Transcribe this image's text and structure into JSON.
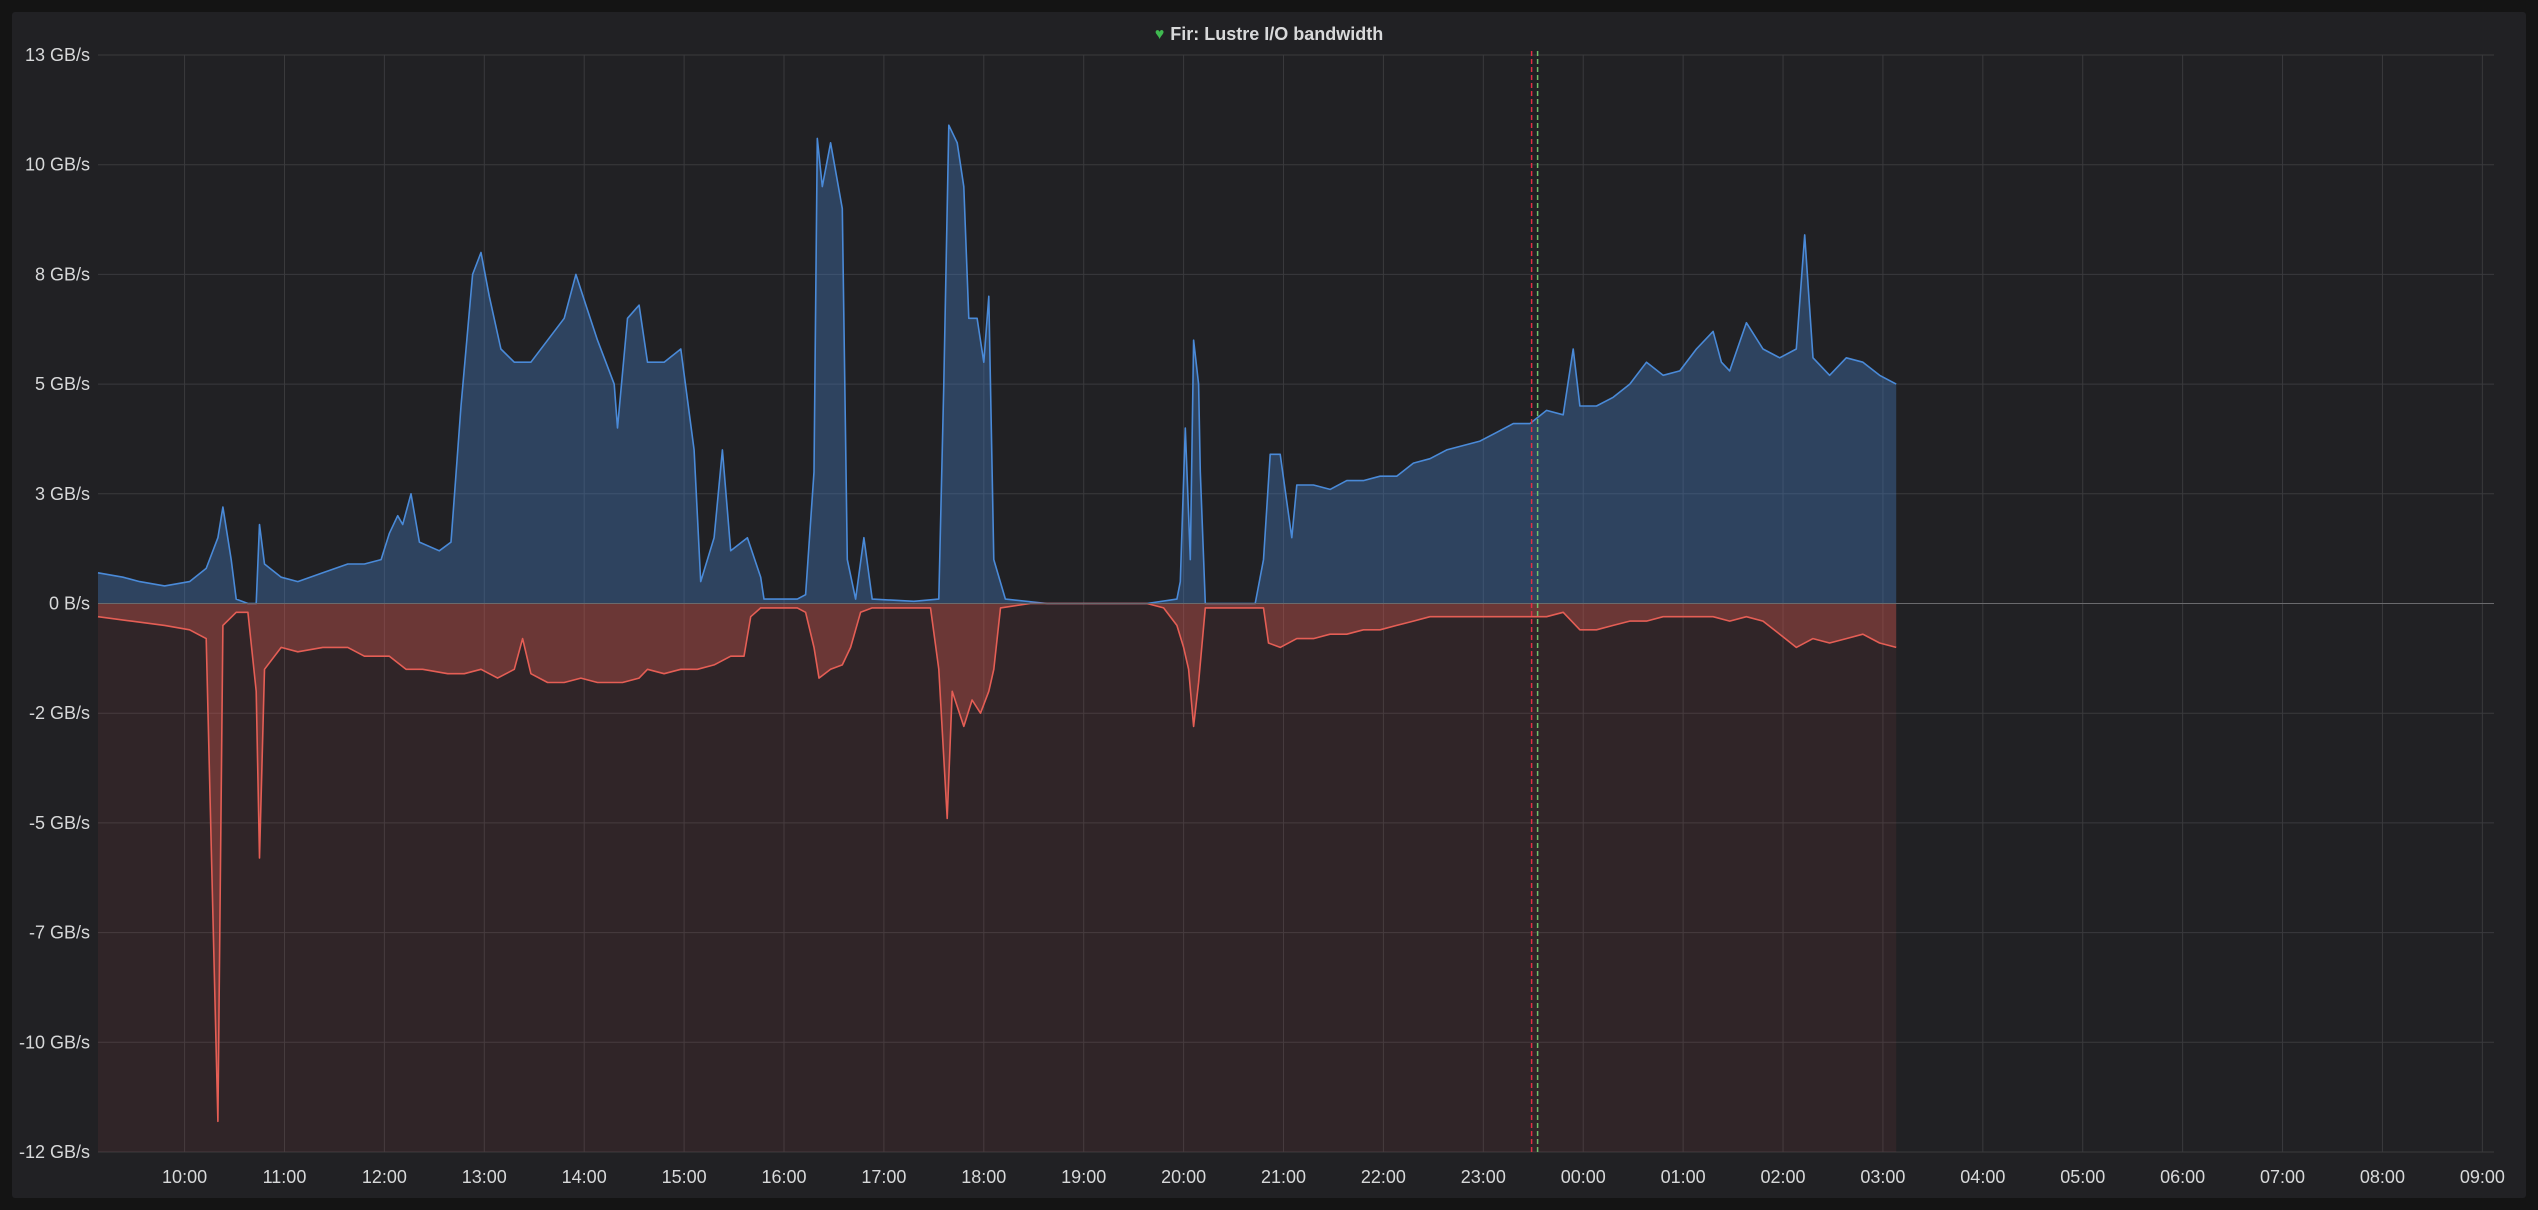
{
  "panel": {
    "title": "Fir: Lustre I/O bandwidth",
    "status_icon": "heart-icon",
    "status_color": "#3fb950"
  },
  "colors": {
    "read": "#4a8ad8",
    "write": "#e55f55",
    "annotation_red": "#e02f44",
    "annotation_green": "#73bf69"
  },
  "chart_data": {
    "type": "area",
    "title": "Fir: Lustre I/O bandwidth",
    "xlabel": "",
    "ylabel": "",
    "y_unit": "GB/s",
    "ylim": [
      -12.5,
      12.5
    ],
    "grid": true,
    "legend": "none",
    "y_ticks": [
      {
        "value": 12.5,
        "label": "13 GB/s"
      },
      {
        "value": 10.0,
        "label": "10 GB/s"
      },
      {
        "value": 7.5,
        "label": "8 GB/s"
      },
      {
        "value": 5.0,
        "label": "5 GB/s"
      },
      {
        "value": 2.5,
        "label": "3 GB/s"
      },
      {
        "value": 0.0,
        "label": "0 B/s"
      },
      {
        "value": -2.5,
        "label": "-2 GB/s"
      },
      {
        "value": -5.0,
        "label": "-5 GB/s"
      },
      {
        "value": -7.5,
        "label": "-7 GB/s"
      },
      {
        "value": -10.0,
        "label": "-10 GB/s"
      },
      {
        "value": -12.5,
        "label": "-12 GB/s"
      }
    ],
    "x_range": [
      "09:08",
      "09:07"
    ],
    "x_ticks": [
      "10:00",
      "11:00",
      "12:00",
      "13:00",
      "14:00",
      "15:00",
      "16:00",
      "17:00",
      "18:00",
      "19:00",
      "20:00",
      "21:00",
      "22:00",
      "23:00",
      "00:00",
      "01:00",
      "02:00",
      "03:00",
      "04:00",
      "05:00",
      "06:00",
      "07:00",
      "08:00",
      "09:00"
    ],
    "annotation_time": "23:29",
    "series": [
      {
        "values": [
          [
            0,
            0.7
          ],
          [
            15,
            0.6
          ],
          [
            25,
            0.5
          ],
          [
            40,
            0.4
          ],
          [
            55,
            0.5
          ],
          [
            65,
            0.8
          ],
          [
            72,
            1.5
          ],
          [
            75,
            2.2
          ],
          [
            80,
            1.0
          ],
          [
            83,
            0.1
          ],
          [
            90,
            0.0
          ],
          [
            95,
            0.0
          ],
          [
            97,
            1.8
          ],
          [
            100,
            0.9
          ],
          [
            110,
            0.6
          ],
          [
            120,
            0.5
          ],
          [
            135,
            0.7
          ],
          [
            150,
            0.9
          ],
          [
            160,
            0.9
          ],
          [
            170,
            1.0
          ],
          [
            175,
            1.6
          ],
          [
            180,
            2.0
          ],
          [
            183,
            1.8
          ],
          [
            188,
            2.5
          ],
          [
            193,
            1.4
          ],
          [
            205,
            1.2
          ],
          [
            212,
            1.4
          ],
          [
            218,
            4.5
          ],
          [
            225,
            7.5
          ],
          [
            230,
            8.0
          ],
          [
            235,
            7.0
          ],
          [
            242,
            5.8
          ],
          [
            250,
            5.5
          ],
          [
            260,
            5.5
          ],
          [
            270,
            6.0
          ],
          [
            280,
            6.5
          ],
          [
            287,
            7.5
          ],
          [
            293,
            6.8
          ],
          [
            300,
            6.0
          ],
          [
            310,
            5.0
          ],
          [
            312,
            4.0
          ],
          [
            318,
            6.5
          ],
          [
            325,
            6.8
          ],
          [
            330,
            5.5
          ],
          [
            340,
            5.5
          ],
          [
            350,
            5.8
          ],
          [
            358,
            3.5
          ],
          [
            362,
            0.5
          ],
          [
            370,
            1.5
          ],
          [
            375,
            3.5
          ],
          [
            380,
            1.2
          ],
          [
            390,
            1.5
          ],
          [
            398,
            0.6
          ],
          [
            400,
            0.1
          ],
          [
            420,
            0.1
          ],
          [
            425,
            0.2
          ],
          [
            430,
            3.0
          ],
          [
            432,
            10.6
          ],
          [
            435,
            9.5
          ],
          [
            440,
            10.5
          ],
          [
            447,
            9.0
          ],
          [
            450,
            1.0
          ],
          [
            455,
            0.1
          ],
          [
            460,
            1.5
          ],
          [
            465,
            0.1
          ],
          [
            490,
            0.05
          ],
          [
            505,
            0.1
          ],
          [
            508,
            5.0
          ],
          [
            511,
            10.9
          ],
          [
            516,
            10.5
          ],
          [
            520,
            9.5
          ],
          [
            523,
            6.5
          ],
          [
            528,
            6.5
          ],
          [
            532,
            5.5
          ],
          [
            535,
            7.0
          ],
          [
            538,
            1.0
          ],
          [
            545,
            0.1
          ],
          [
            570,
            0.0
          ],
          [
            630,
            0.0
          ],
          [
            648,
            0.1
          ],
          [
            650,
            0.5
          ],
          [
            653,
            4.0
          ],
          [
            656,
            1.0
          ],
          [
            658,
            6.0
          ],
          [
            661,
            5.0
          ],
          [
            662,
            3.0
          ],
          [
            665,
            0.0
          ],
          [
            680,
            0.0
          ],
          [
            695,
            0.0
          ],
          [
            700,
            1.0
          ],
          [
            704,
            3.4
          ],
          [
            710,
            3.4
          ],
          [
            717,
            1.5
          ],
          [
            720,
            2.7
          ],
          [
            730,
            2.7
          ],
          [
            740,
            2.6
          ],
          [
            750,
            2.8
          ],
          [
            760,
            2.8
          ],
          [
            770,
            2.9
          ],
          [
            780,
            2.9
          ],
          [
            790,
            3.2
          ],
          [
            800,
            3.3
          ],
          [
            810,
            3.5
          ],
          [
            820,
            3.6
          ],
          [
            830,
            3.7
          ],
          [
            840,
            3.9
          ],
          [
            850,
            4.1
          ],
          [
            860,
            4.1
          ],
          [
            870,
            4.4
          ],
          [
            880,
            4.3
          ],
          [
            886,
            5.8
          ],
          [
            890,
            4.5
          ],
          [
            900,
            4.5
          ],
          [
            910,
            4.7
          ],
          [
            920,
            5.0
          ],
          [
            930,
            5.5
          ],
          [
            940,
            5.2
          ],
          [
            950,
            5.3
          ],
          [
            960,
            5.8
          ],
          [
            970,
            6.2
          ],
          [
            975,
            5.5
          ],
          [
            980,
            5.3
          ],
          [
            990,
            6.4
          ],
          [
            1000,
            5.8
          ],
          [
            1010,
            5.6
          ],
          [
            1020,
            5.8
          ],
          [
            1025,
            8.4
          ],
          [
            1030,
            5.6
          ],
          [
            1040,
            5.2
          ],
          [
            1050,
            5.6
          ],
          [
            1060,
            5.5
          ],
          [
            1070,
            5.2
          ],
          [
            1080,
            5.0
          ]
        ]
      },
      {
        "values": [
          [
            0,
            -0.3
          ],
          [
            20,
            -0.4
          ],
          [
            40,
            -0.5
          ],
          [
            55,
            -0.6
          ],
          [
            65,
            -0.8
          ],
          [
            72,
            -11.8
          ],
          [
            75,
            -0.5
          ],
          [
            83,
            -0.2
          ],
          [
            90,
            -0.2
          ],
          [
            95,
            -2.0
          ],
          [
            97,
            -5.8
          ],
          [
            100,
            -1.5
          ],
          [
            110,
            -1.0
          ],
          [
            120,
            -1.1
          ],
          [
            135,
            -1.0
          ],
          [
            150,
            -1.0
          ],
          [
            160,
            -1.2
          ],
          [
            175,
            -1.2
          ],
          [
            185,
            -1.5
          ],
          [
            195,
            -1.5
          ],
          [
            210,
            -1.6
          ],
          [
            220,
            -1.6
          ],
          [
            230,
            -1.5
          ],
          [
            240,
            -1.7
          ],
          [
            250,
            -1.5
          ],
          [
            255,
            -0.8
          ],
          [
            260,
            -1.6
          ],
          [
            270,
            -1.8
          ],
          [
            280,
            -1.8
          ],
          [
            290,
            -1.7
          ],
          [
            300,
            -1.8
          ],
          [
            315,
            -1.8
          ],
          [
            325,
            -1.7
          ],
          [
            330,
            -1.5
          ],
          [
            340,
            -1.6
          ],
          [
            350,
            -1.5
          ],
          [
            360,
            -1.5
          ],
          [
            370,
            -1.4
          ],
          [
            380,
            -1.2
          ],
          [
            388,
            -1.2
          ],
          [
            392,
            -0.3
          ],
          [
            398,
            -0.1
          ],
          [
            420,
            -0.1
          ],
          [
            425,
            -0.2
          ],
          [
            430,
            -1.0
          ],
          [
            433,
            -1.7
          ],
          [
            440,
            -1.5
          ],
          [
            447,
            -1.4
          ],
          [
            452,
            -1.0
          ],
          [
            458,
            -0.2
          ],
          [
            465,
            -0.1
          ],
          [
            490,
            -0.1
          ],
          [
            500,
            -0.1
          ],
          [
            505,
            -1.5
          ],
          [
            510,
            -4.9
          ],
          [
            513,
            -2.0
          ],
          [
            520,
            -2.8
          ],
          [
            525,
            -2.2
          ],
          [
            530,
            -2.5
          ],
          [
            535,
            -2.0
          ],
          [
            538,
            -1.5
          ],
          [
            542,
            -0.1
          ],
          [
            560,
            -0.0
          ],
          [
            630,
            -0.0
          ],
          [
            640,
            -0.1
          ],
          [
            648,
            -0.5
          ],
          [
            652,
            -1.0
          ],
          [
            655,
            -1.5
          ],
          [
            658,
            -2.8
          ],
          [
            661,
            -1.8
          ],
          [
            665,
            -0.1
          ],
          [
            700,
            -0.1
          ],
          [
            703,
            -0.9
          ],
          [
            710,
            -1.0
          ],
          [
            720,
            -0.8
          ],
          [
            730,
            -0.8
          ],
          [
            740,
            -0.7
          ],
          [
            750,
            -0.7
          ],
          [
            760,
            -0.6
          ],
          [
            770,
            -0.6
          ],
          [
            780,
            -0.5
          ],
          [
            790,
            -0.4
          ],
          [
            800,
            -0.3
          ],
          [
            810,
            -0.3
          ],
          [
            830,
            -0.3
          ],
          [
            850,
            -0.3
          ],
          [
            870,
            -0.3
          ],
          [
            880,
            -0.2
          ],
          [
            890,
            -0.6
          ],
          [
            900,
            -0.6
          ],
          [
            910,
            -0.5
          ],
          [
            920,
            -0.4
          ],
          [
            930,
            -0.4
          ],
          [
            940,
            -0.3
          ],
          [
            960,
            -0.3
          ],
          [
            970,
            -0.3
          ],
          [
            980,
            -0.4
          ],
          [
            990,
            -0.3
          ],
          [
            1000,
            -0.4
          ],
          [
            1010,
            -0.7
          ],
          [
            1020,
            -1.0
          ],
          [
            1030,
            -0.8
          ],
          [
            1040,
            -0.9
          ],
          [
            1050,
            -0.8
          ],
          [
            1060,
            -0.7
          ],
          [
            1070,
            -0.9
          ],
          [
            1080,
            -1.0
          ]
        ]
      }
    ]
  }
}
